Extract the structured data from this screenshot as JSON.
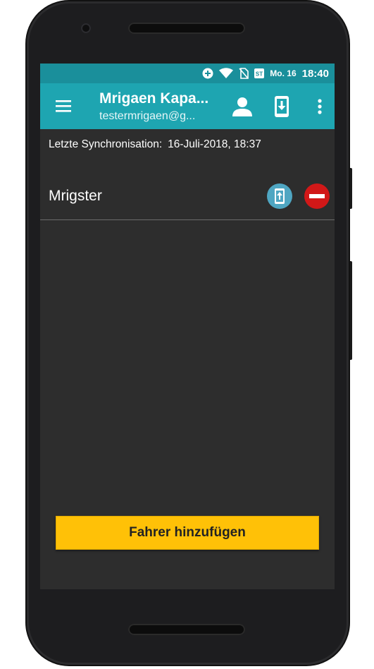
{
  "status_bar": {
    "date": "Mo. 16",
    "time": "18:40",
    "icons": [
      "add-circle-icon",
      "wifi-icon",
      "no-sim-icon",
      "st-notification-icon"
    ]
  },
  "app_bar": {
    "title": "Mrigaen Kapa...",
    "subtitle": "testermrigaen@g...",
    "icons": [
      "menu-icon",
      "person-icon",
      "download-icon",
      "more-vert-icon"
    ]
  },
  "sync": {
    "label": "Letzte Synchronisation:",
    "value": "16-Juli-2018, 18:37"
  },
  "drivers": [
    {
      "name": "Mrigster"
    }
  ],
  "add_driver_button": {
    "label": "Fahrer hinzufügen"
  },
  "colors": {
    "status_bar": "#1a8f9b",
    "app_bar": "#1ea5b1",
    "screen_bg": "#2d2d2d",
    "accent_button": "#ffc107",
    "upload_button": "#4fa6c2",
    "remove_button": "#d11818"
  }
}
